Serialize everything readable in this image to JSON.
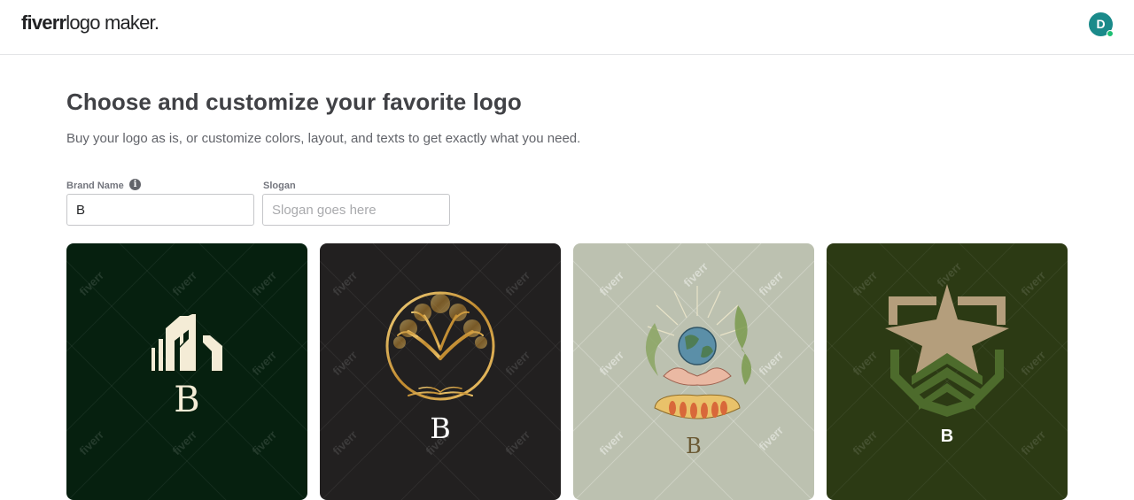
{
  "header": {
    "logo_brand": "fiverr",
    "logo_product": "logo maker.",
    "avatar_initial": "D"
  },
  "main": {
    "title": "Choose and customize your favorite logo",
    "subtitle": "Buy your logo as is, or customize colors, layout, and texts to get exactly what you need."
  },
  "form": {
    "brand_label": "Brand Name",
    "brand_value": "B",
    "slogan_label": "Slogan",
    "slogan_placeholder": "Slogan goes here"
  },
  "cards": [
    {
      "letter": "B",
      "bg": "#06200f",
      "icon": "buildings-icon"
    },
    {
      "letter": "B",
      "bg": "#222020",
      "icon": "tree-of-life-icon"
    },
    {
      "letter": "B",
      "bg": "#bcc1b0",
      "icon": "earth-in-hands-icon"
    },
    {
      "letter": "B",
      "bg": "#2c3a14",
      "icon": "star-chevron-emblem-icon"
    }
  ],
  "watermark_text": "fiverr",
  "colors": {
    "accent_green": "#1dbf73",
    "avatar_bg": "#1a8a8a",
    "text_dark": "#404145"
  }
}
